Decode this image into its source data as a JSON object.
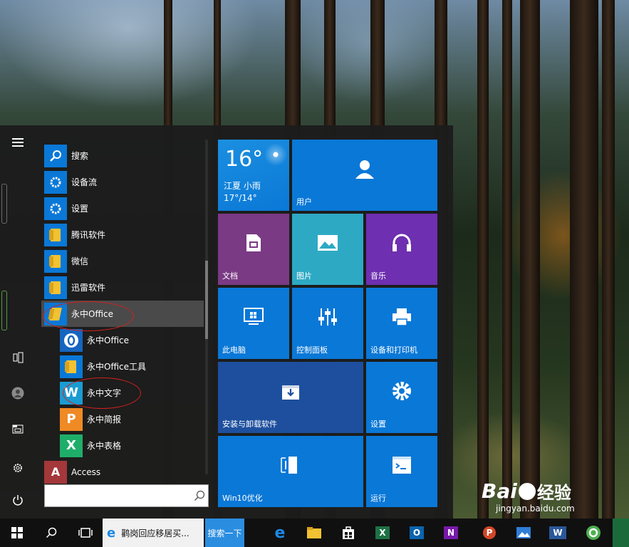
{
  "start_menu": {
    "apps": [
      {
        "label": "搜索",
        "icon": "search-icon"
      },
      {
        "label": "设备流",
        "icon": "gear-icon"
      },
      {
        "label": "设置",
        "icon": "gear-icon"
      },
      {
        "label": "腾讯软件",
        "icon": "folder-icon"
      },
      {
        "label": "微信",
        "icon": "folder-icon"
      },
      {
        "label": "迅雷软件",
        "icon": "folder-icon"
      },
      {
        "label": "永中Office",
        "icon": "folder-open-icon"
      },
      {
        "label": "永中Office",
        "icon": "yozo-office-icon"
      },
      {
        "label": "永中Office工具",
        "icon": "folder-icon"
      },
      {
        "label": "永中文字",
        "icon": "yozo-writer-icon"
      },
      {
        "label": "永中简报",
        "icon": "yozo-presentation-icon"
      },
      {
        "label": "永中表格",
        "icon": "yozo-sheet-icon"
      },
      {
        "label": "Access",
        "icon": "access-icon"
      }
    ],
    "search_placeholder": "",
    "rail_icons": [
      "hamburger-icon",
      "tablet-icon",
      "user-icon",
      "file-explorer-icon",
      "settings-icon",
      "power-icon"
    ]
  },
  "tiles": {
    "weather": {
      "temp": "16°",
      "location": "江夏 小雨",
      "range": "17°/14°"
    },
    "user": "用户",
    "documents": "文档",
    "pictures": "图片",
    "music": "音乐",
    "this_pc": "此电脑",
    "control_panel": "控制面板",
    "devices_printers": "设备和打印机",
    "install_uninstall": "安装与卸载软件",
    "settings": "设置",
    "win10_optimize": "Win10优化",
    "run": "运行",
    "colors": {
      "blue": "#0a78d7",
      "purple": "#7a3a84",
      "teal": "#2ea9c4",
      "violet": "#6e2fb0",
      "navy": "#1d4f9e"
    }
  },
  "taskbar": {
    "ie_window_title": "鹳岗回应移居买...",
    "search_button": "搜索一下",
    "icons": [
      "windows-logo-icon",
      "search-icon",
      "task-view-icon",
      "ie-icon",
      "edge-icon",
      "file-explorer-icon",
      "store-icon",
      "excel-icon",
      "outlook-icon",
      "onenote-icon",
      "powerpoint-icon",
      "photos-icon",
      "word-icon",
      "360-icon",
      "app-icon"
    ]
  },
  "watermark": {
    "brand": "Bai",
    "brand_cn": "经验",
    "url": "jingyan.baidu.com"
  }
}
